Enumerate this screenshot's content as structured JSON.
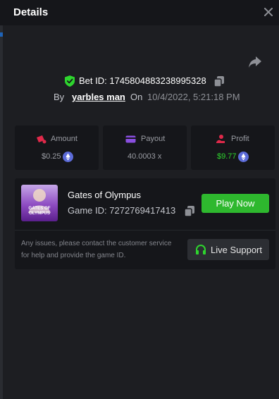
{
  "header": {
    "title": "Details",
    "close_icon": "close-icon"
  },
  "share_icon": "share-icon",
  "bet": {
    "label": "Bet ID: ",
    "id": "1745804883238995328",
    "by_label": "By",
    "username": "yarbles man",
    "on_label": "On",
    "date": "10/4/2022, 5:21:18 PM"
  },
  "stats": {
    "amount": {
      "label": "Amount",
      "value": "$0.25",
      "icon": "amount-icon",
      "coin": "eth-coin-icon"
    },
    "payout": {
      "label": "Payout",
      "value": "40.0003 x",
      "icon": "payout-card-icon"
    },
    "profit": {
      "label": "Profit",
      "value": "$9.77",
      "icon": "profit-icon",
      "coin": "eth-coin-icon"
    }
  },
  "game": {
    "title": "Gates of Olympus",
    "id_label": "Game ID: ",
    "id": "7272769417413",
    "thumb_text_line1": "GATES OF",
    "thumb_text_line2": "OLYMPUS",
    "play_label": "Play Now",
    "issue_text": "Any issues, please contact the customer service for help and provide the game ID.",
    "support_label": "Live Support"
  },
  "colors": {
    "accent_green": "#2eb82e",
    "profit_green": "#2ed52e",
    "icon_red": "#e0294a",
    "icon_purple": "#8a4fe0",
    "coin_blue": "#5c6bd8"
  }
}
